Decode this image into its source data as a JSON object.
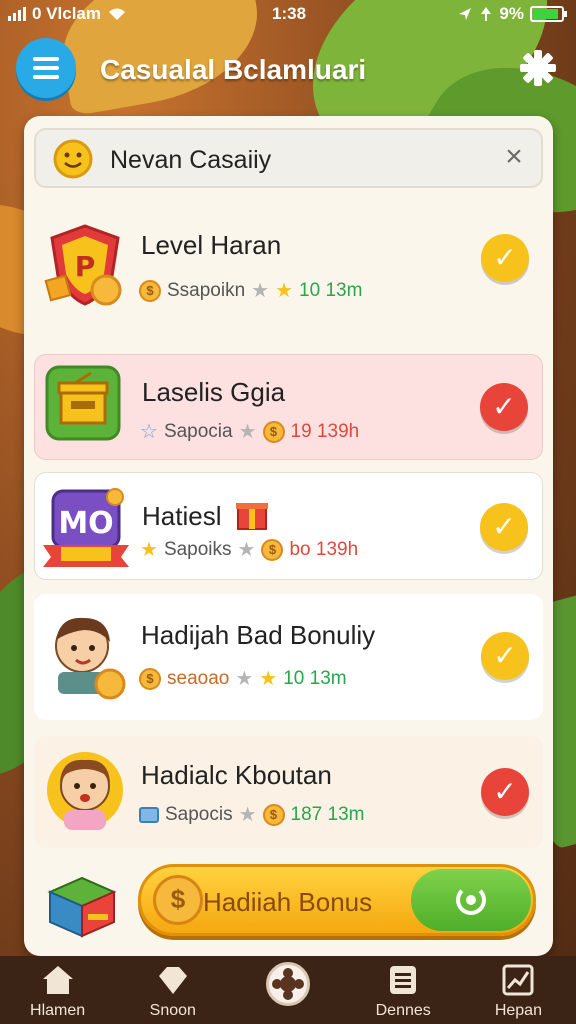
{
  "status_bar": {
    "carrier": "0 Vlclam",
    "time": "1:38",
    "battery": "9%",
    "battery_level": 0.9
  },
  "header": {
    "title": "Casualal Bclamluari"
  },
  "search": {
    "label": "Nevan Casaiiy"
  },
  "rewards": [
    {
      "title": "Level Haran",
      "label": "Ssapoikn",
      "value": "10 13m",
      "status": "yellow",
      "colors": {
        "check": "#f7c21c"
      }
    },
    {
      "title": "Laselis  Ggia",
      "label": "Sapocia",
      "value": "19 139h",
      "status": "red",
      "colors": {
        "check": "#e8443a"
      }
    },
    {
      "title": "Hatiesl",
      "label": "Sapoiks",
      "value": "bo 139h",
      "status": "yellow",
      "colors": {
        "check": "#f7c21c"
      }
    },
    {
      "title": "Hadijah Bad Bonuliy",
      "label": "seaoao",
      "value": "10 13m",
      "status": "yellow",
      "colors": {
        "check": "#f7c21c"
      }
    },
    {
      "title": "Hadialc Kboutan",
      "label": "Sapocis",
      "value": "187 13m",
      "status": "red",
      "colors": {
        "check": "#e8443a"
      }
    }
  ],
  "bonus": {
    "label": "Hadiiah Bonus"
  },
  "nav": [
    {
      "label": "Hlamen",
      "icon": "home-icon"
    },
    {
      "label": "Snoon",
      "icon": "diamond-icon"
    },
    {
      "label": "",
      "icon": "center-icon"
    },
    {
      "label": "Dennes",
      "icon": "list-icon"
    },
    {
      "label": "Hepan",
      "icon": "chart-icon"
    }
  ]
}
